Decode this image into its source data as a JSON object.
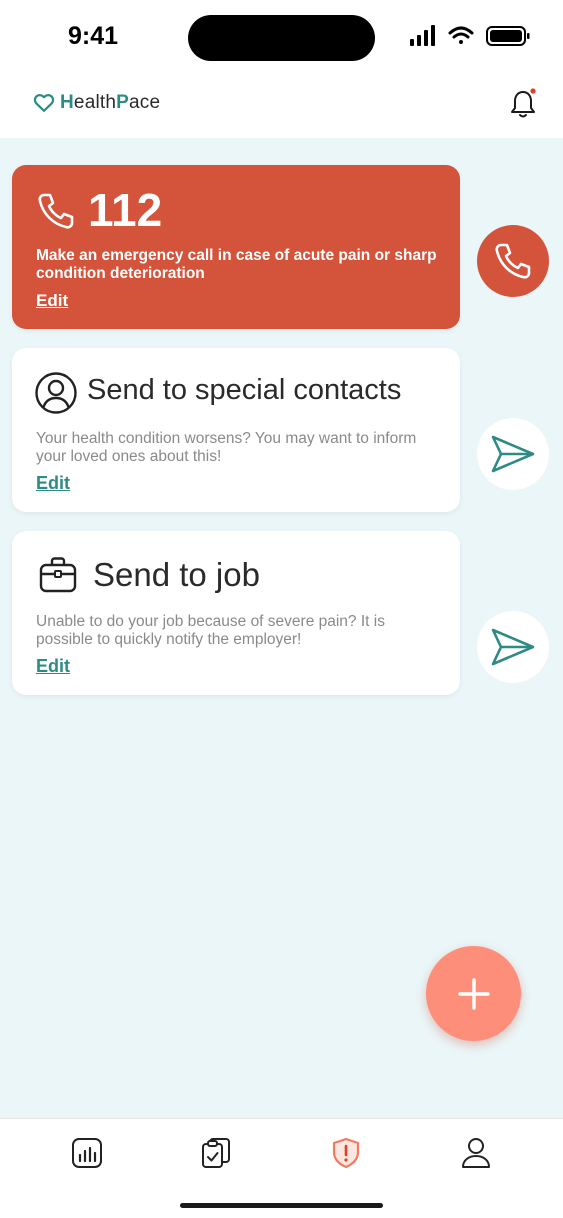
{
  "status_bar": {
    "time": "9:41"
  },
  "header": {
    "logo_prefix": "H",
    "logo_mid": "ealth",
    "logo_p": "P",
    "logo_suffix": "ace"
  },
  "cards": {
    "emergency": {
      "number": "112",
      "description": "Make an emergency call in case of acute pain or sharp condition deterioration",
      "edit": "Edit"
    },
    "contacts": {
      "title": "Send to special contacts",
      "description": "Your health condition worsens? You may want to inform your loved ones about this!",
      "edit": "Edit"
    },
    "job": {
      "title": "Send to job",
      "description": "Unable to do your job because of severe pain? It is possible to quickly notify the employer!",
      "edit": "Edit"
    }
  },
  "tabs": [
    "chart-icon",
    "clipboard-check-icon",
    "shield-alert-icon",
    "user-icon"
  ],
  "colors": {
    "accent": "#2e8a85",
    "emergency": "#d4533b",
    "fab": "#fc8e7a",
    "background": "#eaf6f8"
  }
}
